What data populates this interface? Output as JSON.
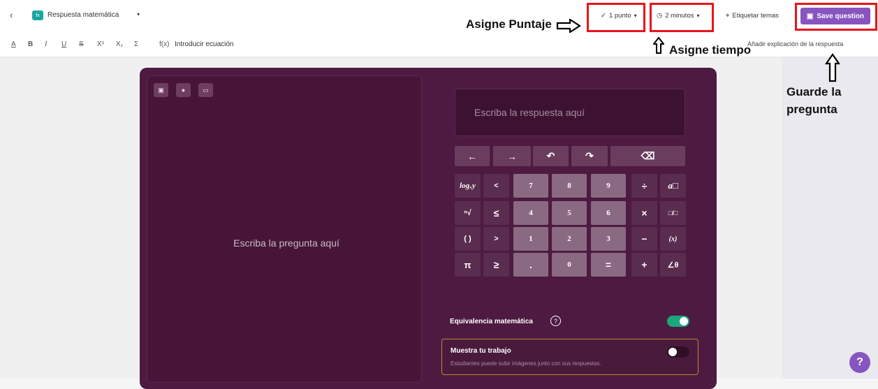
{
  "header": {
    "back_icon": "chevron-left-icon",
    "question_type_label": "Respuesta matemática",
    "question_type_icon": "fx",
    "points_label": "1 punto",
    "time_label": "2 minutos",
    "tag_label": "Etiquetar temas",
    "save_label": "Save question",
    "accent_color": "#8854c0"
  },
  "format_toolbar": {
    "buttons": [
      "A",
      "B",
      "I",
      "U",
      "S",
      "X¹",
      "X₁",
      "Σ"
    ],
    "equation_label": "Introducir ecuación",
    "equation_icon": "f(x)",
    "explanation_label": "Añadir explicación de la respuesta"
  },
  "question": {
    "placeholder": "Escriba la pregunta aquí",
    "media_buttons": [
      "image-icon",
      "mic-icon",
      "video-icon"
    ]
  },
  "answer": {
    "placeholder": "Escriba la respuesta aquí"
  },
  "keypad": {
    "nav_row": [
      "←",
      "→",
      "↶",
      "↷",
      "⌫"
    ],
    "rows": [
      [
        "logₓy",
        "<",
        "7",
        "8",
        "9",
        "÷",
        "a□"
      ],
      [
        "ⁿ√",
        "≤",
        "4",
        "5",
        "6",
        "×",
        "□/□"
      ],
      [
        "( )",
        ">",
        "1",
        "2",
        "3",
        "−",
        "(x)"
      ],
      [
        "π",
        "≥",
        ".",
        "0",
        "=",
        "+",
        "∠θ"
      ]
    ]
  },
  "settings": {
    "equivalence_label": "Equivalencia matemática",
    "equivalence_on": true,
    "show_work_label": "Muestra tu trabajo",
    "show_work_sub": "Estudiantes puede subir imágenes junto con sus respuestas.",
    "show_work_on": false
  },
  "annotations": {
    "score": "Asigne Puntaje",
    "time": "Asigne tiempo",
    "save_line1": "Guarde la",
    "save_line2": "pregunta"
  },
  "help_label": "?"
}
